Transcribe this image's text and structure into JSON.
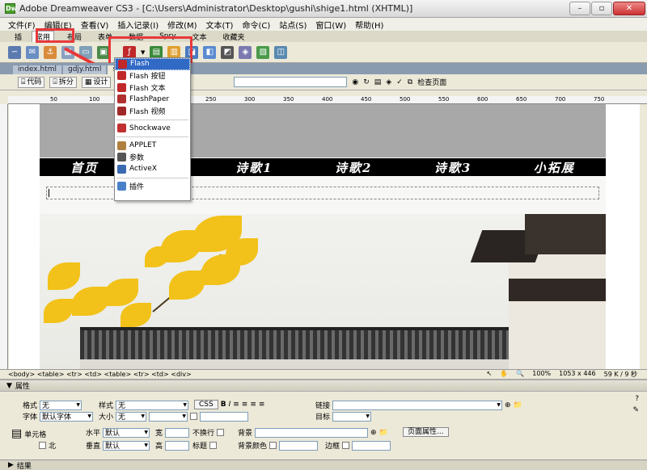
{
  "window": {
    "title": "Adobe Dreamweaver CS3 - [C:\\Users\\Administrator\\Desktop\\gushi\\shige1.html (XHTML)]",
    "app_icon": "Dw"
  },
  "menu": [
    "文件(F)",
    "编辑(E)",
    "查看(V)",
    "插入记录(I)",
    "修改(M)",
    "文本(T)",
    "命令(C)",
    "站点(S)",
    "窗口(W)",
    "帮助(H)"
  ],
  "insert_bar": {
    "label": "插",
    "tabs": [
      "常用",
      "布局",
      "表单",
      "数据",
      "Spry",
      "文本",
      "收藏夹"
    ]
  },
  "doc_tabs": [
    "index.html",
    "gdjy.html",
    "sh"
  ],
  "doc_toolbar": {
    "code": "代码",
    "split": "拆分",
    "design": "设计",
    "check": "检查页面"
  },
  "ruler_marks": [
    "50",
    "100",
    "150",
    "200",
    "250",
    "300",
    "350",
    "400",
    "450",
    "500",
    "550",
    "600",
    "650",
    "700",
    "750"
  ],
  "page": {
    "nav": [
      "首页",
      "语",
      "诗歌1",
      "诗歌2",
      "诗歌3",
      "小拓展"
    ]
  },
  "flash_menu": [
    {
      "label": "Flash",
      "icon": "flash-icon",
      "selected": true
    },
    {
      "label": "Flash 按钮",
      "icon": "flash-button-icon"
    },
    {
      "label": "Flash 文本",
      "icon": "flash-text-icon"
    },
    {
      "label": "FlashPaper",
      "icon": "flashpaper-icon"
    },
    {
      "label": "Flash 视频",
      "icon": "flash-video-icon"
    },
    {
      "label": "Shockwave",
      "icon": "shockwave-icon"
    },
    {
      "label": "APPLET",
      "icon": "applet-icon"
    },
    {
      "label": "参数",
      "icon": "param-icon"
    },
    {
      "label": "ActiveX",
      "icon": "activex-icon"
    },
    {
      "label": "插件",
      "icon": "plugin-icon"
    }
  ],
  "status": {
    "path": "<body> <table> <tr> <td> <table> <tr> <td> <div>",
    "zoom": "100%",
    "size": "1053 x 446",
    "weight": "59 K / 9 秒"
  },
  "properties": {
    "title": "属性",
    "format_label": "格式",
    "format_value": "无",
    "style_label": "样式",
    "style_value": "无",
    "css_btn": "CSS",
    "bold": "B",
    "italic": "I",
    "link_label": "链接",
    "font_label": "字体",
    "font_value": "默认字体",
    "size_label": "大小",
    "size_value": "无",
    "target_label": "目标",
    "cell_label": "单元格",
    "horiz_label": "水平",
    "horiz_value": "默认",
    "vert_label": "垂直",
    "vert_value": "默认",
    "width_label": "宽",
    "height_label": "高",
    "nowrap_label": "不换行",
    "header_label": "标题",
    "bg_label": "背景",
    "bgcolor_label": "背景颜色",
    "border_label": "边框",
    "page_props_btn": "页面属性...",
    "merge_label": "北"
  },
  "results_panel": "结果",
  "colors": {
    "highlight": "#e8383a",
    "selection": "#316ac5",
    "leaf": "#f2c21a"
  }
}
